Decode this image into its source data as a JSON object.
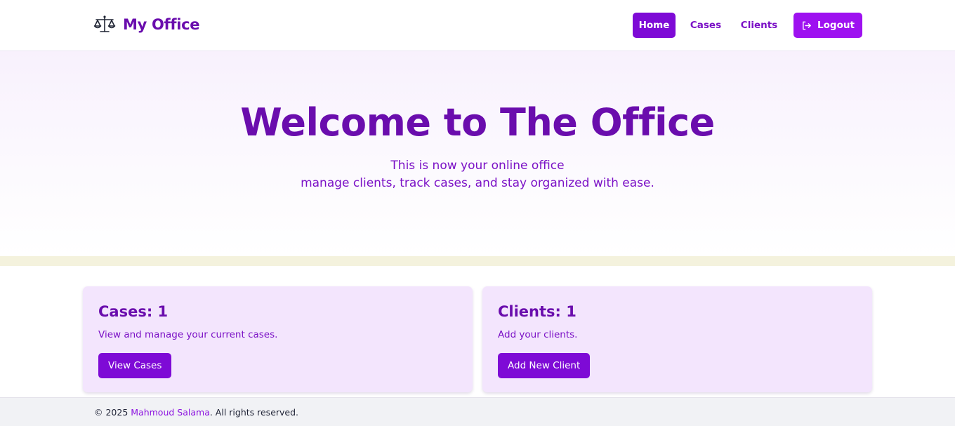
{
  "navbar": {
    "brand": "My Office",
    "brand_icon": "scales-icon",
    "links": [
      {
        "label": "Home",
        "active": true
      },
      {
        "label": "Cases",
        "active": false
      },
      {
        "label": "Clients",
        "active": false
      }
    ],
    "logout_label": "Logout",
    "logout_icon": "logout-icon"
  },
  "hero": {
    "title": "Welcome to The Office",
    "subtitle_line1": "This is now your online office",
    "subtitle_line2": "manage clients, track cases, and stay organized with ease."
  },
  "cards": [
    {
      "title": "Cases: 1",
      "description": "View and manage your current cases.",
      "button": "View Cases"
    },
    {
      "title": "Clients: 1",
      "description": "Add your clients.",
      "button": "Add New Client"
    }
  ],
  "footer": {
    "prefix": "© 2025 ",
    "author": "Mahmoud Salama",
    "suffix": ". All rights reserved."
  },
  "colors": {
    "primary": "#6a0dad",
    "button": "#7e0ad6",
    "logout_button": "#9e11f0",
    "card_bg": "#f3e5fd",
    "band": "#f4f2dd",
    "footer_bg": "#f1f2f5"
  }
}
